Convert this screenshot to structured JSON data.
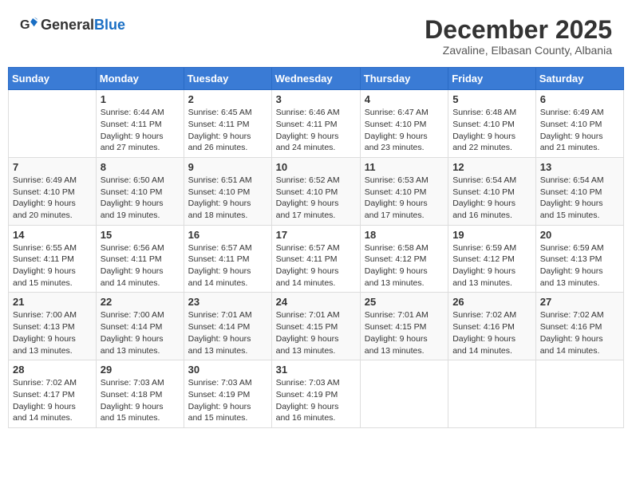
{
  "header": {
    "logo_general": "General",
    "logo_blue": "Blue",
    "month_title": "December 2025",
    "subtitle": "Zavaline, Elbasan County, Albania"
  },
  "calendar": {
    "days_of_week": [
      "Sunday",
      "Monday",
      "Tuesday",
      "Wednesday",
      "Thursday",
      "Friday",
      "Saturday"
    ],
    "weeks": [
      [
        {
          "day": "",
          "info": ""
        },
        {
          "day": "1",
          "info": "Sunrise: 6:44 AM\nSunset: 4:11 PM\nDaylight: 9 hours\nand 27 minutes."
        },
        {
          "day": "2",
          "info": "Sunrise: 6:45 AM\nSunset: 4:11 PM\nDaylight: 9 hours\nand 26 minutes."
        },
        {
          "day": "3",
          "info": "Sunrise: 6:46 AM\nSunset: 4:11 PM\nDaylight: 9 hours\nand 24 minutes."
        },
        {
          "day": "4",
          "info": "Sunrise: 6:47 AM\nSunset: 4:10 PM\nDaylight: 9 hours\nand 23 minutes."
        },
        {
          "day": "5",
          "info": "Sunrise: 6:48 AM\nSunset: 4:10 PM\nDaylight: 9 hours\nand 22 minutes."
        },
        {
          "day": "6",
          "info": "Sunrise: 6:49 AM\nSunset: 4:10 PM\nDaylight: 9 hours\nand 21 minutes."
        }
      ],
      [
        {
          "day": "7",
          "info": "Sunrise: 6:49 AM\nSunset: 4:10 PM\nDaylight: 9 hours\nand 20 minutes."
        },
        {
          "day": "8",
          "info": "Sunrise: 6:50 AM\nSunset: 4:10 PM\nDaylight: 9 hours\nand 19 minutes."
        },
        {
          "day": "9",
          "info": "Sunrise: 6:51 AM\nSunset: 4:10 PM\nDaylight: 9 hours\nand 18 minutes."
        },
        {
          "day": "10",
          "info": "Sunrise: 6:52 AM\nSunset: 4:10 PM\nDaylight: 9 hours\nand 17 minutes."
        },
        {
          "day": "11",
          "info": "Sunrise: 6:53 AM\nSunset: 4:10 PM\nDaylight: 9 hours\nand 17 minutes."
        },
        {
          "day": "12",
          "info": "Sunrise: 6:54 AM\nSunset: 4:10 PM\nDaylight: 9 hours\nand 16 minutes."
        },
        {
          "day": "13",
          "info": "Sunrise: 6:54 AM\nSunset: 4:10 PM\nDaylight: 9 hours\nand 15 minutes."
        }
      ],
      [
        {
          "day": "14",
          "info": "Sunrise: 6:55 AM\nSunset: 4:11 PM\nDaylight: 9 hours\nand 15 minutes."
        },
        {
          "day": "15",
          "info": "Sunrise: 6:56 AM\nSunset: 4:11 PM\nDaylight: 9 hours\nand 14 minutes."
        },
        {
          "day": "16",
          "info": "Sunrise: 6:57 AM\nSunset: 4:11 PM\nDaylight: 9 hours\nand 14 minutes."
        },
        {
          "day": "17",
          "info": "Sunrise: 6:57 AM\nSunset: 4:11 PM\nDaylight: 9 hours\nand 14 minutes."
        },
        {
          "day": "18",
          "info": "Sunrise: 6:58 AM\nSunset: 4:12 PM\nDaylight: 9 hours\nand 13 minutes."
        },
        {
          "day": "19",
          "info": "Sunrise: 6:59 AM\nSunset: 4:12 PM\nDaylight: 9 hours\nand 13 minutes."
        },
        {
          "day": "20",
          "info": "Sunrise: 6:59 AM\nSunset: 4:13 PM\nDaylight: 9 hours\nand 13 minutes."
        }
      ],
      [
        {
          "day": "21",
          "info": "Sunrise: 7:00 AM\nSunset: 4:13 PM\nDaylight: 9 hours\nand 13 minutes."
        },
        {
          "day": "22",
          "info": "Sunrise: 7:00 AM\nSunset: 4:14 PM\nDaylight: 9 hours\nand 13 minutes."
        },
        {
          "day": "23",
          "info": "Sunrise: 7:01 AM\nSunset: 4:14 PM\nDaylight: 9 hours\nand 13 minutes."
        },
        {
          "day": "24",
          "info": "Sunrise: 7:01 AM\nSunset: 4:15 PM\nDaylight: 9 hours\nand 13 minutes."
        },
        {
          "day": "25",
          "info": "Sunrise: 7:01 AM\nSunset: 4:15 PM\nDaylight: 9 hours\nand 13 minutes."
        },
        {
          "day": "26",
          "info": "Sunrise: 7:02 AM\nSunset: 4:16 PM\nDaylight: 9 hours\nand 14 minutes."
        },
        {
          "day": "27",
          "info": "Sunrise: 7:02 AM\nSunset: 4:16 PM\nDaylight: 9 hours\nand 14 minutes."
        }
      ],
      [
        {
          "day": "28",
          "info": "Sunrise: 7:02 AM\nSunset: 4:17 PM\nDaylight: 9 hours\nand 14 minutes."
        },
        {
          "day": "29",
          "info": "Sunrise: 7:03 AM\nSunset: 4:18 PM\nDaylight: 9 hours\nand 15 minutes."
        },
        {
          "day": "30",
          "info": "Sunrise: 7:03 AM\nSunset: 4:19 PM\nDaylight: 9 hours\nand 15 minutes."
        },
        {
          "day": "31",
          "info": "Sunrise: 7:03 AM\nSunset: 4:19 PM\nDaylight: 9 hours\nand 16 minutes."
        },
        {
          "day": "",
          "info": ""
        },
        {
          "day": "",
          "info": ""
        },
        {
          "day": "",
          "info": ""
        }
      ]
    ]
  }
}
